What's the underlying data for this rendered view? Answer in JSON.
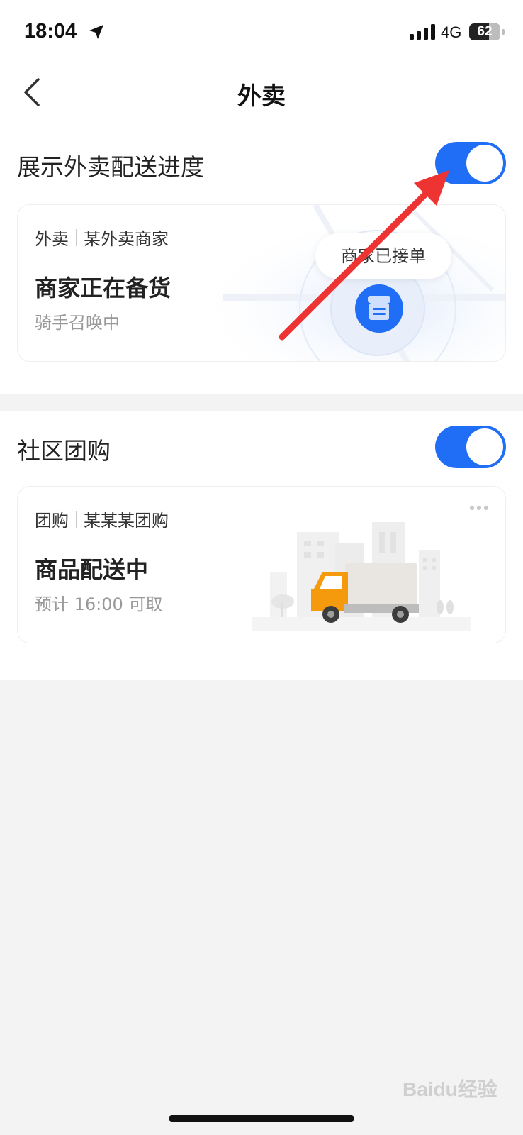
{
  "status_bar": {
    "time": "18:04",
    "network": "4G",
    "battery": "62"
  },
  "nav": {
    "title": "外卖"
  },
  "delivery_section": {
    "label": "展示外卖配送进度",
    "toggle_on": true,
    "card": {
      "tag_category": "外卖",
      "tag_merchant": "某外卖商家",
      "status": "商家正在备货",
      "sub": "骑手召唤中",
      "bubble": "商家已接单"
    }
  },
  "group_section": {
    "label": "社区团购",
    "toggle_on": true,
    "card": {
      "tag_category": "团购",
      "tag_merchant": "某某某团购",
      "status": "商品配送中",
      "sub": "预计 16:00 可取"
    }
  },
  "watermark": "Baidu经验",
  "colors": {
    "accent": "#1f6ef5",
    "annotation_arrow": "#ee3333"
  }
}
